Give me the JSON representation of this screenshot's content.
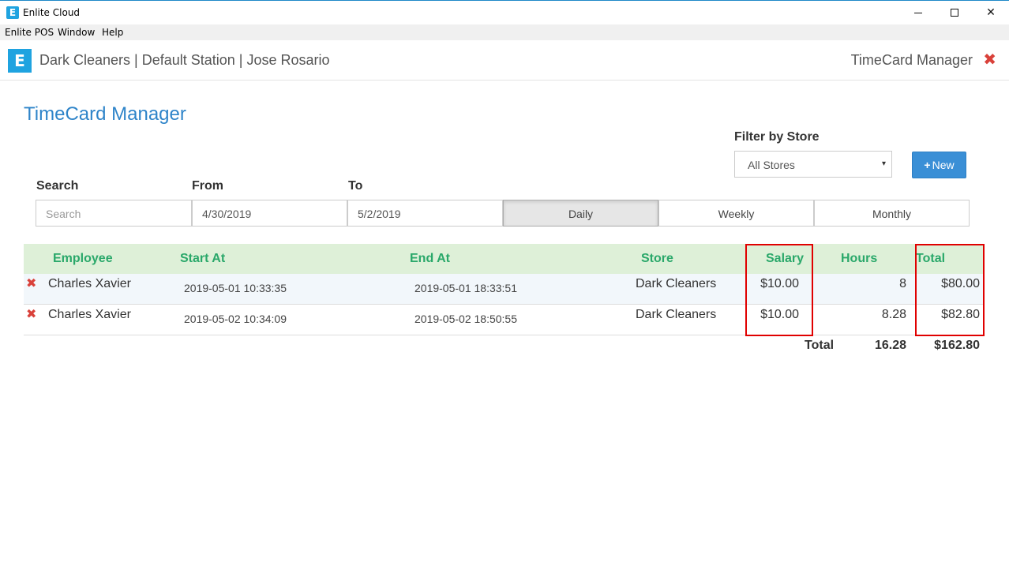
{
  "window": {
    "title": "Enlite Cloud",
    "icon_letter": "E",
    "minimize_icon": "minimize-icon",
    "maximize_icon": "maximize-icon",
    "close_symbol": "✕"
  },
  "menu": {
    "items": [
      "Enlite POS",
      "Window",
      "Help"
    ]
  },
  "header": {
    "logo_letter": "E",
    "context": "Dark Cleaners | Default Station | Jose Rosario",
    "module": "TimeCard Manager",
    "close_symbol": "✖"
  },
  "page": {
    "title": "TimeCard Manager"
  },
  "filter": {
    "label": "Filter by Store",
    "selected": "All Stores",
    "caret": "▾"
  },
  "new_button": {
    "icon": "+",
    "label": "New"
  },
  "search": {
    "label": "Search",
    "placeholder": "Search",
    "value": ""
  },
  "from": {
    "label": "From",
    "value": "4/30/2019"
  },
  "to": {
    "label": "To",
    "value": "5/2/2019"
  },
  "periods": [
    {
      "label": "Daily",
      "active": true
    },
    {
      "label": "Weekly",
      "active": false
    },
    {
      "label": "Monthly",
      "active": false
    }
  ],
  "table": {
    "columns": [
      "Employee",
      "Start At",
      "End At",
      "Store",
      "Salary",
      "Hours",
      "Total"
    ],
    "rows": [
      {
        "delete_symbol": "✖",
        "employee": "Charles Xavier",
        "start_at": "2019-05-01 10:33:35",
        "end_at": "2019-05-01 18:33:51",
        "store": "Dark Cleaners",
        "salary": "$10.00",
        "hours": "8",
        "total": "$80.00"
      },
      {
        "delete_symbol": "✖",
        "employee": "Charles Xavier",
        "start_at": "2019-05-02 10:34:09",
        "end_at": "2019-05-02 18:50:55",
        "store": "Dark Cleaners",
        "salary": "$10.00",
        "hours": "8.28",
        "total": "$82.80"
      }
    ],
    "totals": {
      "label": "Total",
      "hours": "16.28",
      "amount": "$162.80"
    }
  },
  "colors": {
    "accent": "#2e84c9",
    "header_green": "#2aa86a",
    "header_bg": "#def0d8",
    "delete_red": "#d9413a",
    "highlight_red": "#e00000"
  }
}
